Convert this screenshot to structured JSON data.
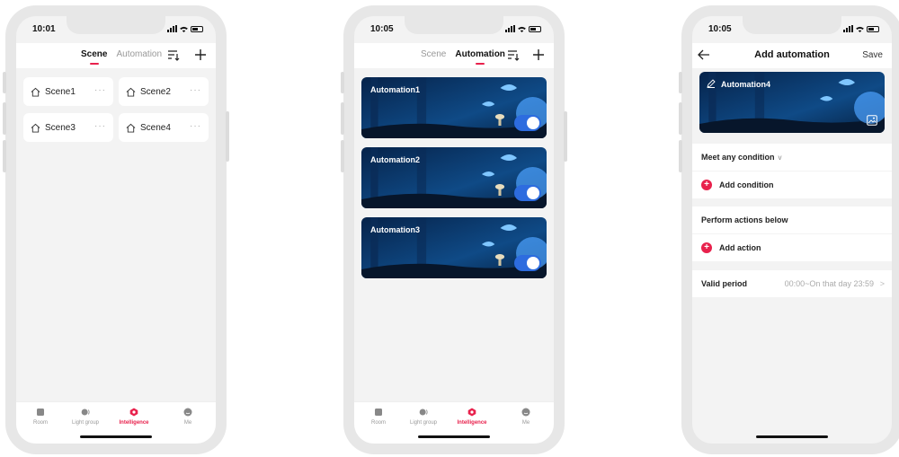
{
  "status": {
    "time1": "10:01",
    "time2": "10:05",
    "time3": "10:05"
  },
  "screen1": {
    "tabs": [
      {
        "label": "Scene",
        "active": true
      },
      {
        "label": "Automation",
        "active": false
      }
    ],
    "scenes": [
      {
        "name": "Scene1"
      },
      {
        "name": "Scene2"
      },
      {
        "name": "Scene3"
      },
      {
        "name": "Scene4"
      }
    ],
    "more": "···"
  },
  "screen2": {
    "tabs": [
      {
        "label": "Scene",
        "active": false
      },
      {
        "label": "Automation",
        "active": true
      }
    ],
    "automations": [
      {
        "name": "Automation1",
        "enabled": true
      },
      {
        "name": "Automation2",
        "enabled": true
      },
      {
        "name": "Automation3",
        "enabled": true
      }
    ]
  },
  "bottom_nav": [
    {
      "label": "Room",
      "icon": "room-icon"
    },
    {
      "label": "Light group",
      "icon": "light-group-icon"
    },
    {
      "label": "Intelligence",
      "icon": "intelligence-icon",
      "active": true
    },
    {
      "label": "Me",
      "icon": "me-icon"
    }
  ],
  "screen3": {
    "title": "Add automation",
    "save": "Save",
    "automation_name": "Automation4",
    "condition_header": "Meet any condition",
    "condition_chevron": "v",
    "add_condition": "Add condition",
    "actions_header": "Perform actions below",
    "add_action": "Add action",
    "valid_period_label": "Valid period",
    "valid_period_value": "00:00~On that day 23:59",
    "chevron": ">"
  },
  "colors": {
    "accent": "#e8214c",
    "toggle": "#2d6cdf"
  }
}
